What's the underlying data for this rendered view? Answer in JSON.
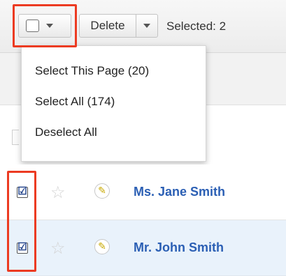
{
  "toolbar": {
    "select_menu_icon": "checkbox-icon",
    "delete_label": "Delete",
    "selected_label": "Selected: 2"
  },
  "dropdown": {
    "items": [
      {
        "label": "Select This Page (20)"
      },
      {
        "label": "Select All (174)"
      },
      {
        "label": "Deselect All"
      }
    ]
  },
  "rows": [
    {
      "name": "Ms. Jane Smith",
      "checked": true,
      "checkbox_glyph": "☑",
      "star_icon": "star-outline-icon",
      "edit_icon": "pencil-icon"
    },
    {
      "name": "Mr. John Smith",
      "checked": true,
      "checkbox_glyph": "☑",
      "star_icon": "star-outline-icon",
      "edit_icon": "pencil-icon"
    }
  ],
  "colors": {
    "highlight": "#ec3b22",
    "link": "#2b5fb4",
    "selected_row_bg": "#e9f2fb"
  }
}
